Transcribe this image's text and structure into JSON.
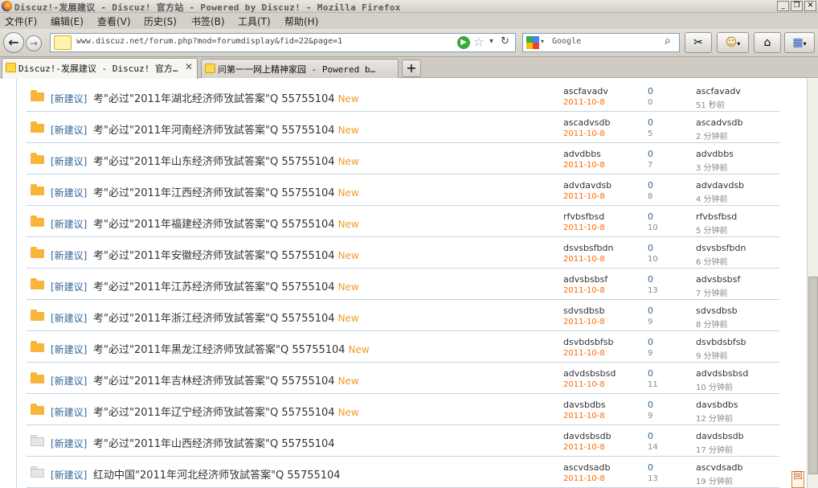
{
  "window": {
    "title": "Discuz!-发展建议 - Discuz! 官方站 - Powered by Discuz! - Mozilla Firefox",
    "buttons": {
      "minimize": "_",
      "restore": "❐",
      "close": "✕"
    }
  },
  "menu": [
    "文件(F)",
    "编辑(E)",
    "查看(V)",
    "历史(S)",
    "书签(B)",
    "工具(T)",
    "帮助(H)"
  ],
  "nav": {
    "url": "www.discuz.net/forum.php?mod=forumdisplay&fid=22&page=1",
    "search_engine": "Google",
    "back_icon": "←",
    "forward_icon": "→"
  },
  "tabs": [
    {
      "label": "Discuz!-发展建议 - Discuz! 官方…",
      "active": true
    },
    {
      "label": "问第一一网上精神家园 - Powered b…",
      "active": false
    }
  ],
  "newtab_label": "+",
  "colors": {
    "new_folder": "#f8b53a",
    "type_link": "#336699",
    "date": "#ff6600",
    "new_tag": "#f29c27"
  },
  "threads": [
    {
      "type": "[新建议]",
      "title": "考\"必过\"2011年湖北经济师攷試答案\"Q 55755104",
      "new": "New",
      "author": "ascfavadv",
      "date": "2011-10-8",
      "replies": "0",
      "views": "0",
      "last_user": "ascfavadv",
      "last_time": "51 秒前"
    },
    {
      "type": "[新建议]",
      "title": "考\"必过\"2011年河南经济师攷試答案\"Q 55755104",
      "new": "New",
      "author": "ascadvsdb",
      "date": "2011-10-8",
      "replies": "0",
      "views": "5",
      "last_user": "ascadvsdb",
      "last_time": "2 分钟前"
    },
    {
      "type": "[新建议]",
      "title": "考\"必过\"2011年山东经济师攷試答案\"Q 55755104",
      "new": "New",
      "author": "advdbbs",
      "date": "2011-10-8",
      "replies": "0",
      "views": "7",
      "last_user": "advdbbs",
      "last_time": "3 分钟前"
    },
    {
      "type": "[新建议]",
      "title": "考\"必过\"2011年江西经济师攷試答案\"Q 55755104",
      "new": "New",
      "author": "advdavdsb",
      "date": "2011-10-8",
      "replies": "0",
      "views": "8",
      "last_user": "advdavdsb",
      "last_time": "4 分钟前"
    },
    {
      "type": "[新建议]",
      "title": "考\"必过\"2011年福建经济师攷試答案\"Q 55755104",
      "new": "New",
      "author": "rfvbsfbsd",
      "date": "2011-10-8",
      "replies": "0",
      "views": "10",
      "last_user": "rfvbsfbsd",
      "last_time": "5 分钟前"
    },
    {
      "type": "[新建议]",
      "title": "考\"必过\"2011年安徽经济师攷試答案\"Q 55755104",
      "new": "New",
      "author": "dsvsbsfbdn",
      "date": "2011-10-8",
      "replies": "0",
      "views": "10",
      "last_user": "dsvsbsfbdn",
      "last_time": "6 分钟前"
    },
    {
      "type": "[新建议]",
      "title": "考\"必过\"2011年江苏经济师攷試答案\"Q 55755104",
      "new": "New",
      "author": "advsbsbsf",
      "date": "2011-10-8",
      "replies": "0",
      "views": "13",
      "last_user": "advsbsbsf",
      "last_time": "7 分钟前"
    },
    {
      "type": "[新建议]",
      "title": "考\"必过\"2011年浙江经济师攷試答案\"Q 55755104",
      "new": "New",
      "author": "sdvsdbsb",
      "date": "2011-10-8",
      "replies": "0",
      "views": "9",
      "last_user": "sdvsdbsb",
      "last_time": "8 分钟前"
    },
    {
      "type": "[新建议]",
      "title": "考\"必过\"2011年黑龙江经济师攷試答案\"Q 55755104",
      "new": "New",
      "author": "dsvbdsbfsb",
      "date": "2011-10-8",
      "replies": "0",
      "views": "9",
      "last_user": "dsvbdsbfsb",
      "last_time": "9 分钟前"
    },
    {
      "type": "[新建议]",
      "title": "考\"必过\"2011年吉林经济师攷試答案\"Q 55755104",
      "new": "New",
      "author": "advdsbsbsd",
      "date": "2011-10-8",
      "replies": "0",
      "views": "11",
      "last_user": "advdsbsbsd",
      "last_time": "10 分钟前"
    },
    {
      "type": "[新建议]",
      "title": "考\"必过\"2011年辽宁经济师攷試答案\"Q 55755104",
      "new": "New",
      "author": "davsbdbs",
      "date": "2011-10-8",
      "replies": "0",
      "views": "9",
      "last_user": "davsbdbs",
      "last_time": "12 分钟前"
    },
    {
      "type": "[新建议]",
      "title": "考\"必过\"2011年山西经济师攷試答案\"Q 55755104",
      "new": "",
      "author": "davdsbsdb",
      "date": "2011-10-8",
      "replies": "0",
      "views": "14",
      "last_user": "davdsbsdb",
      "last_time": "17 分钟前"
    },
    {
      "type": "[新建议]",
      "title": "红动中国\"2011年河北经济师攷試答案\"Q 55755104",
      "new": "",
      "author": "ascvdsadb",
      "date": "2011-10-8",
      "replies": "0",
      "views": "13",
      "last_user": "ascvdsadb",
      "last_time": "19 分钟前"
    }
  ],
  "back_to_top": "回"
}
